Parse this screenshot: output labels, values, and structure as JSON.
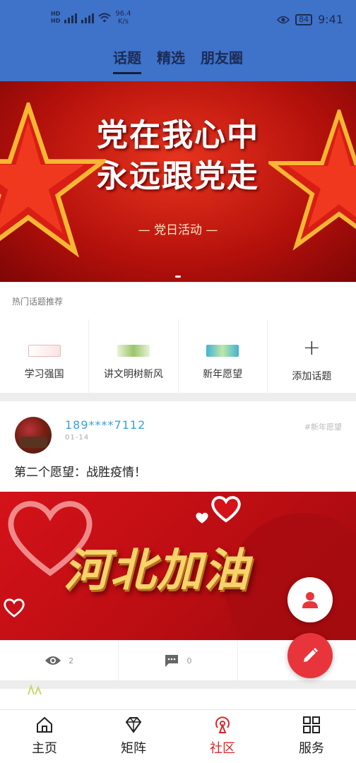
{
  "status_bar": {
    "network_speed_value": "96.4",
    "network_speed_unit": "K/s",
    "battery": "84",
    "time": "9:41"
  },
  "tabs": [
    {
      "label": "话题",
      "active": true
    },
    {
      "label": "精选",
      "active": false
    },
    {
      "label": "朋友圈",
      "active": false
    }
  ],
  "banner": {
    "title_line1": "党在我心中",
    "title_line2": "永远跟党走",
    "subtitle": "— 党日活动 —"
  },
  "hot_topics": {
    "title": "热门话题推荐",
    "items": [
      {
        "label": "学习强国"
      },
      {
        "label": "讲文明树新风"
      },
      {
        "label": "新年愿望"
      },
      {
        "label": "添加话题"
      }
    ]
  },
  "post": {
    "username": "189****7112",
    "date": "01-14",
    "tag": "#新年愿望",
    "content": "第二个愿望：战胜疫情！",
    "image_text": "河北加油",
    "views": "2",
    "comments": "0"
  },
  "bottom_nav": [
    {
      "label": "主页",
      "icon": "home-icon"
    },
    {
      "label": "矩阵",
      "icon": "diamond-icon"
    },
    {
      "label": "社区",
      "icon": "community-icon",
      "active": true
    },
    {
      "label": "服务",
      "icon": "grid-icon"
    }
  ],
  "colors": {
    "header": "#3f72c9",
    "accent": "#d9262a",
    "link": "#3aa0dc"
  }
}
